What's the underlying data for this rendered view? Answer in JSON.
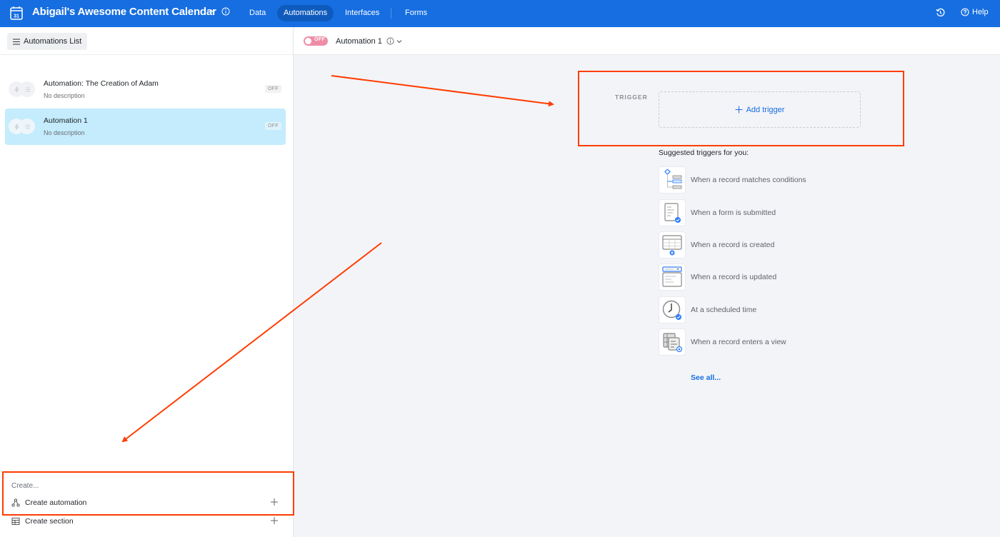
{
  "topbar": {
    "base_title": "Abigail's Awesome Content Calendar",
    "tabs": [
      {
        "label": "Data",
        "active": false
      },
      {
        "label": "Automations",
        "active": true
      },
      {
        "label": "Interfaces",
        "active": false
      },
      {
        "label": "Forms",
        "active": false
      }
    ],
    "help_label": "Help",
    "icons": {
      "base": "calendar-31-icon",
      "history": "history-icon",
      "help": "question-circle-icon"
    },
    "brand_color": "#166ee1"
  },
  "sidebar": {
    "list_toggle_label": "Automations List",
    "automations": [
      {
        "name": "Automation: The Creation of Adam",
        "description": "No description",
        "status": "OFF",
        "selected": false
      },
      {
        "name": "Automation 1",
        "description": "No description",
        "status": "OFF",
        "selected": true
      }
    ],
    "create_label": "Create...",
    "create_items": [
      {
        "label": "Create automation",
        "icon": "flow-icon"
      },
      {
        "label": "Create section",
        "icon": "table-icon"
      }
    ]
  },
  "editor": {
    "toggle_label": "OFF",
    "automation_title": "Automation 1",
    "trigger_label": "TRIGGER",
    "add_trigger_label": "Add trigger",
    "suggested_title": "Suggested triggers for you:",
    "suggested_triggers": [
      {
        "label": "When a record matches conditions",
        "icon": "conditions-icon"
      },
      {
        "label": "When a form is submitted",
        "icon": "form-submitted-icon"
      },
      {
        "label": "When a record is created",
        "icon": "record-created-icon"
      },
      {
        "label": "When a record is updated",
        "icon": "record-updated-icon"
      },
      {
        "label": "At a scheduled time",
        "icon": "clock-icon"
      },
      {
        "label": "When a record enters a view",
        "icon": "view-icon"
      }
    ],
    "see_all_label": "See all..."
  },
  "annotations": {
    "color": "#ff3d00"
  }
}
